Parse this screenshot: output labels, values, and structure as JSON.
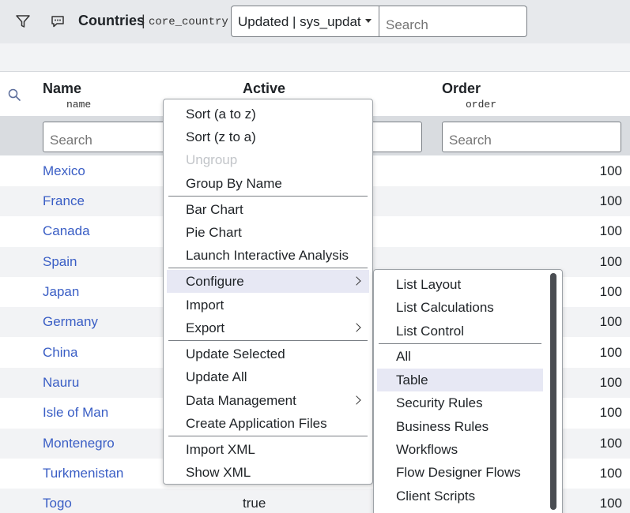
{
  "header": {
    "title": "Countries",
    "separator": "|",
    "table_name": "core_country",
    "select_value": "Updated | sys_updat",
    "search_placeholder": "Search"
  },
  "columns": [
    {
      "label": "Name",
      "field": "name",
      "search_placeholder": "Search"
    },
    {
      "label": "Active",
      "field": "",
      "search_placeholder": ""
    },
    {
      "label": "Order",
      "field": "order",
      "search_placeholder": "Search"
    }
  ],
  "rows": [
    {
      "name": "Mexico",
      "active": "",
      "order": "100"
    },
    {
      "name": "France",
      "active": "",
      "order": "100"
    },
    {
      "name": "Canada",
      "active": "",
      "order": "100"
    },
    {
      "name": "Spain",
      "active": "",
      "order": "100"
    },
    {
      "name": "Japan",
      "active": "",
      "order": "100"
    },
    {
      "name": "Germany",
      "active": "",
      "order": "100"
    },
    {
      "name": "China",
      "active": "",
      "order": "100"
    },
    {
      "name": "Nauru",
      "active": "",
      "order": "100"
    },
    {
      "name": "Isle of Man",
      "active": "",
      "order": "100"
    },
    {
      "name": "Montenegro",
      "active": "",
      "order": "100"
    },
    {
      "name": "Turkmenistan",
      "active": "",
      "order": "100"
    },
    {
      "name": "Togo",
      "active": "true",
      "order": "100"
    }
  ],
  "context_menu": {
    "items": [
      {
        "label": "Sort (a to z)"
      },
      {
        "label": "Sort (z to a)"
      },
      {
        "label": "Ungroup",
        "disabled": true
      },
      {
        "label": "Group By Name"
      },
      {
        "label": "Bar Chart"
      },
      {
        "label": "Pie Chart"
      },
      {
        "label": "Launch Interactive Analysis"
      },
      {
        "label": "Configure",
        "submenu": true,
        "highlighted": true
      },
      {
        "label": "Import"
      },
      {
        "label": "Export",
        "submenu": true
      },
      {
        "label": "Update Selected"
      },
      {
        "label": "Update All"
      },
      {
        "label": "Data Management",
        "submenu": true
      },
      {
        "label": "Create Application Files"
      },
      {
        "label": "Import XML"
      },
      {
        "label": "Show XML"
      }
    ]
  },
  "configure_submenu": {
    "items": [
      {
        "label": "List Layout"
      },
      {
        "label": "List Calculations"
      },
      {
        "label": "List Control"
      },
      {
        "label": "All"
      },
      {
        "label": "Table",
        "highlighted": true
      },
      {
        "label": "Security Rules"
      },
      {
        "label": "Business Rules"
      },
      {
        "label": "Workflows"
      },
      {
        "label": "Flow Designer Flows"
      },
      {
        "label": "Client Scripts"
      }
    ]
  },
  "colors": {
    "link": "#3a5ec5",
    "header_bg": "#e7e9ec",
    "highlight": "#e7e8f4"
  }
}
